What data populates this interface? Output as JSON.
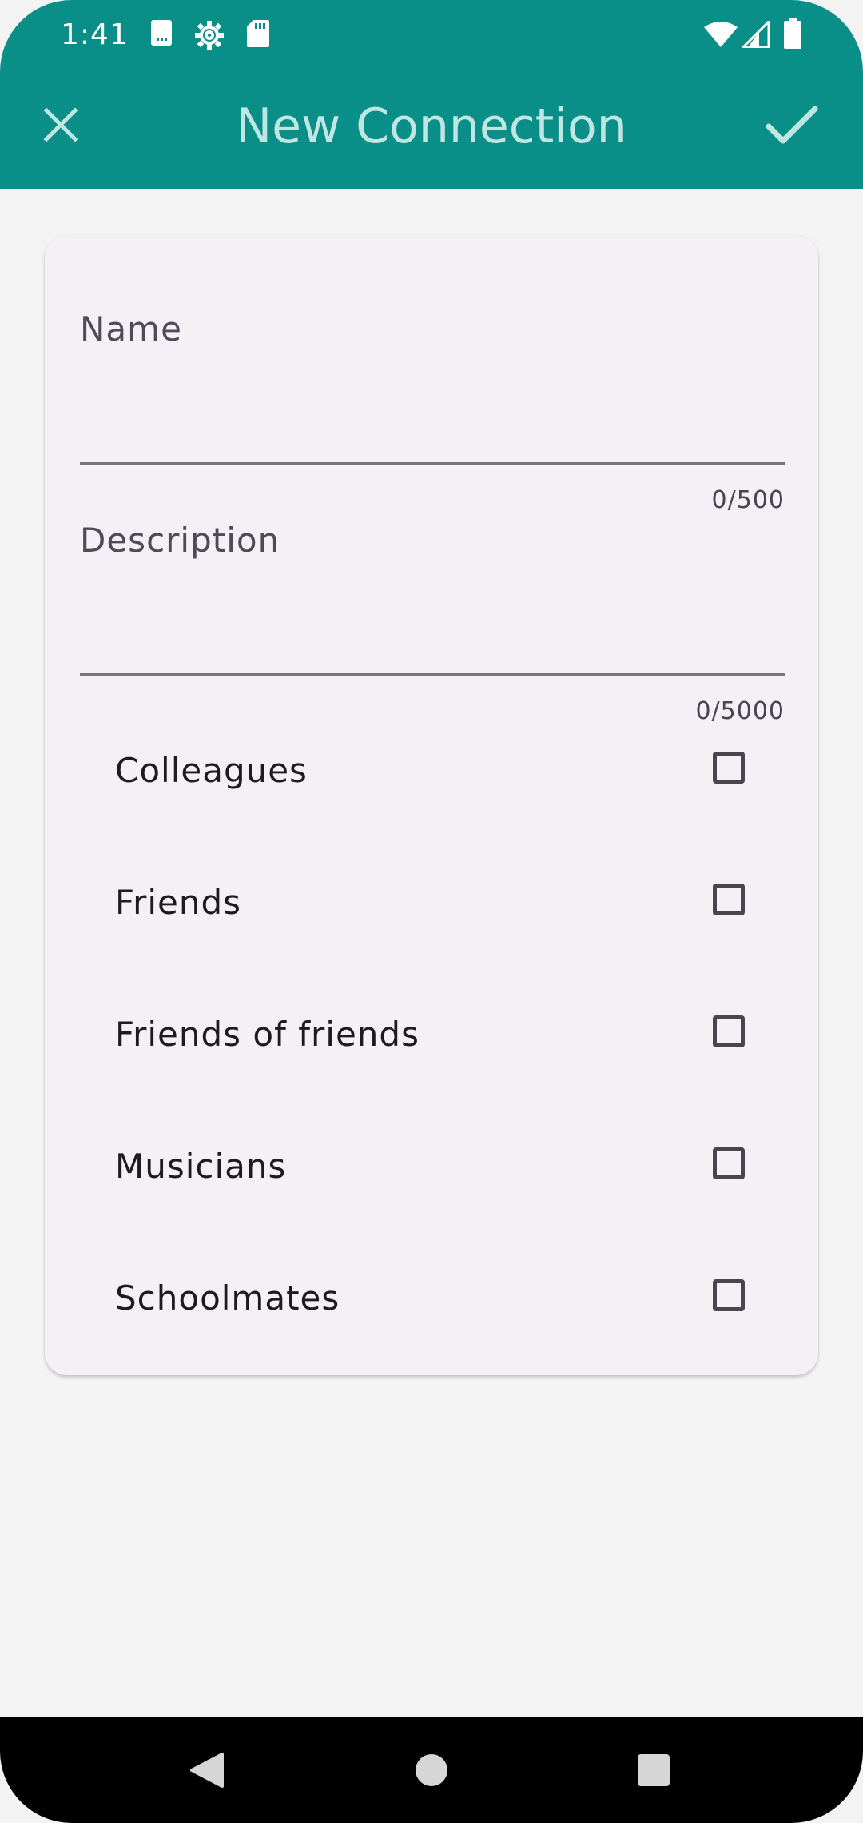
{
  "status_bar": {
    "time": "1:41",
    "left_icons": [
      "sim-card-icon",
      "settings-icon",
      "sd-card-icon"
    ],
    "right_icons": [
      "wifi-icon",
      "signal-icon",
      "battery-icon"
    ]
  },
  "app_bar": {
    "title": "New Connection",
    "close_icon": "close-icon",
    "confirm_icon": "check-icon"
  },
  "form": {
    "name": {
      "placeholder": "Name",
      "value": "",
      "counter": "0/500"
    },
    "description": {
      "placeholder": "Description",
      "value": "",
      "counter": "0/5000"
    },
    "groups": [
      {
        "label": "Colleagues",
        "checked": false
      },
      {
        "label": "Friends",
        "checked": false
      },
      {
        "label": "Friends of friends",
        "checked": false
      },
      {
        "label": "Musicians",
        "checked": false
      },
      {
        "label": "Schoolmates",
        "checked": false
      }
    ]
  },
  "nav_bar": {
    "back_icon": "back-icon",
    "home_icon": "home-icon",
    "recents_icon": "recents-icon"
  },
  "colors": {
    "primary": "#0A8F88",
    "title_text": "#BFE6E2",
    "background": "#F3F3F3",
    "card": "#F4F0F6"
  }
}
